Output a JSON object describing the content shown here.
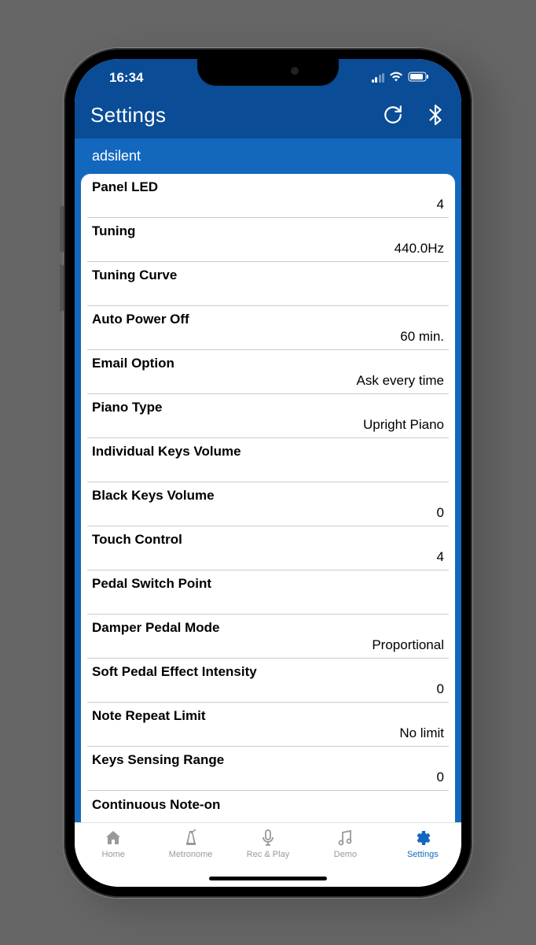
{
  "status": {
    "time": "16:34"
  },
  "header": {
    "title": "Settings"
  },
  "subheader": "adsilent",
  "settings": [
    {
      "label": "Panel LED",
      "value": "4"
    },
    {
      "label": "Tuning",
      "value": "440.0Hz"
    },
    {
      "label": "Tuning Curve",
      "value": ""
    },
    {
      "label": "Auto Power Off",
      "value": "60 min."
    },
    {
      "label": "Email Option",
      "value": "Ask every time"
    },
    {
      "label": "Piano Type",
      "value": "Upright Piano"
    },
    {
      "label": "Individual Keys Volume",
      "value": ""
    },
    {
      "label": "Black Keys Volume",
      "value": "0"
    },
    {
      "label": "Touch Control",
      "value": "4"
    },
    {
      "label": "Pedal Switch Point",
      "value": ""
    },
    {
      "label": "Damper Pedal Mode",
      "value": "Proportional"
    },
    {
      "label": "Soft Pedal Effect Intensity",
      "value": "0"
    },
    {
      "label": "Note Repeat Limit",
      "value": "No limit"
    },
    {
      "label": "Keys Sensing Range",
      "value": "0"
    },
    {
      "label": "Continuous Note-on",
      "value": ""
    }
  ],
  "tabs": [
    {
      "label": "Home",
      "icon": "home"
    },
    {
      "label": "Metronome",
      "icon": "metronome"
    },
    {
      "label": "Rec & Play",
      "icon": "mic"
    },
    {
      "label": "Demo",
      "icon": "music"
    },
    {
      "label": "Settings",
      "icon": "gear",
      "active": true
    }
  ]
}
